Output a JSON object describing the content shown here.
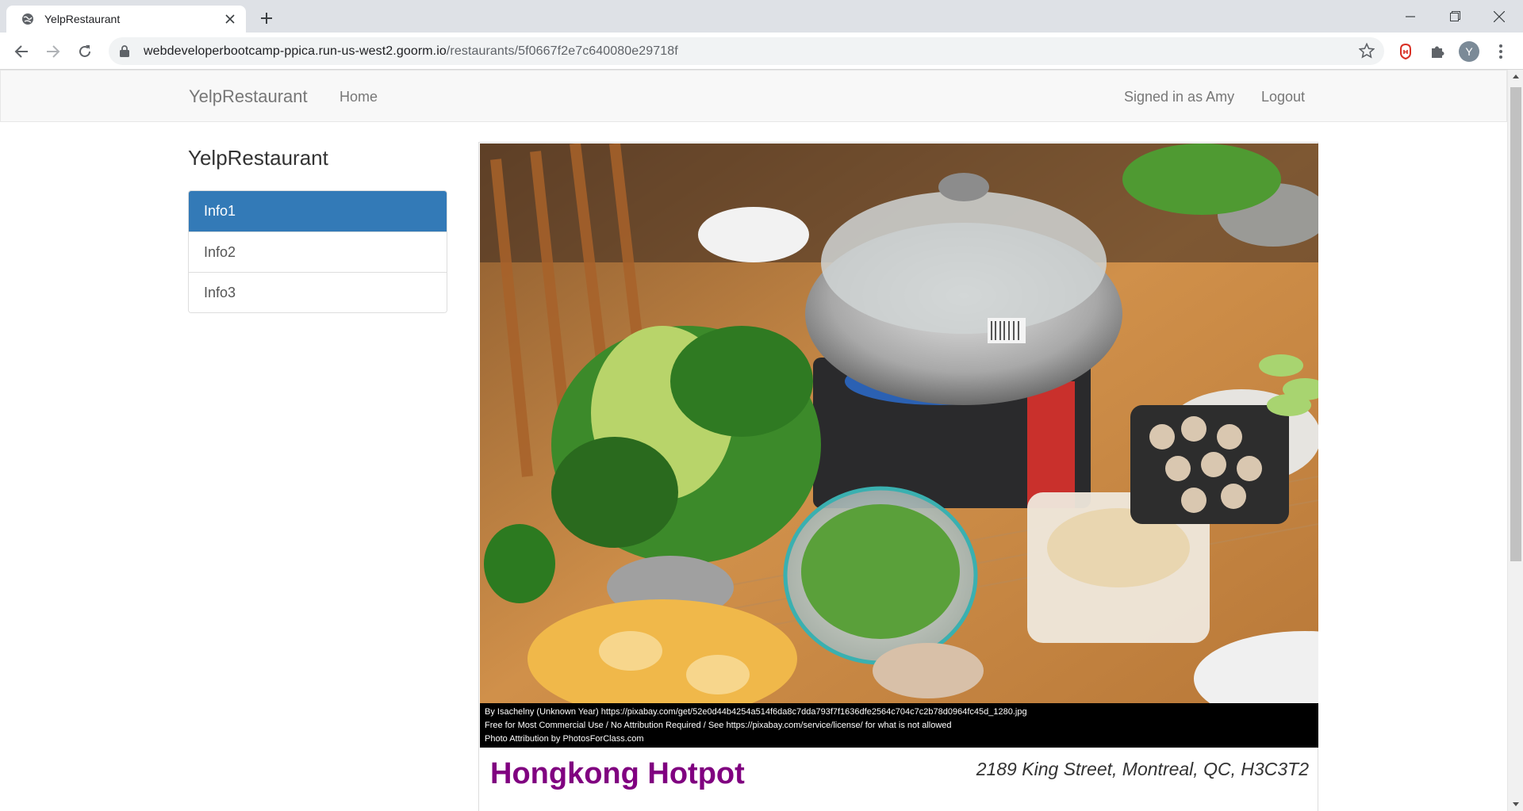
{
  "browser": {
    "tab_title": "YelpRestaurant",
    "url_host": "webdeveloperbootcamp-ppica.run-us-west2.goorm.io",
    "url_path": "/restaurants/5f0667f2e7c640080e29718f",
    "profile_initial": "Y"
  },
  "navbar": {
    "brand": "YelpRestaurant",
    "home": "Home",
    "signed_in": "Signed in as Amy",
    "logout": "Logout"
  },
  "sidebar": {
    "title": "YelpRestaurant",
    "items": [
      {
        "label": "Info1",
        "active": true
      },
      {
        "label": "Info2",
        "active": false
      },
      {
        "label": "Info3",
        "active": false
      }
    ]
  },
  "restaurant": {
    "attribution": [
      "By  Isachelny  (Unknown  Year)  https://pixabay.com/get/52e0d44b4254a514f6da8c7dda793f7f1636dfe2564c704c7c2b78d0964fc45d_1280.jpg",
      "Free for Most Commercial Use / No Attribution Required / See https://pixabay.com/service/license/ for what is not allowed",
      "Photo Attribution by PhotosForClass.com"
    ],
    "name": "Hongkong Hotpot",
    "address": "2189 King Street, Montreal, QC, H3C3T2"
  },
  "colors": {
    "accent": "#337ab7",
    "name": "#800080"
  }
}
